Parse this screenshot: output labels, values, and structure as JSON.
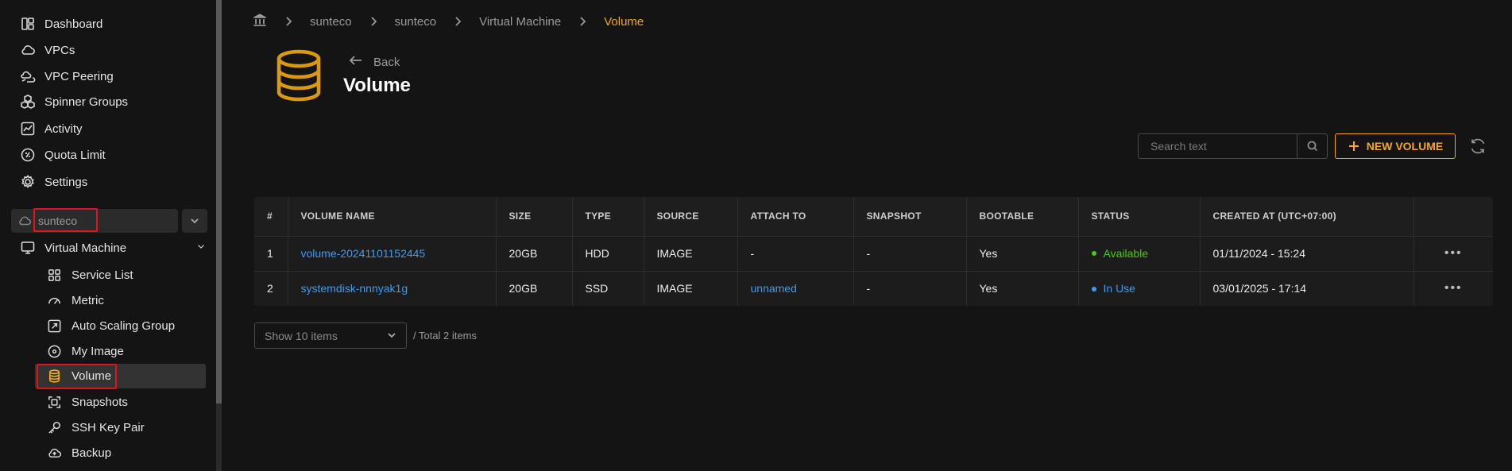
{
  "sidebar": {
    "items": [
      {
        "label": "Dashboard",
        "icon": "dashboard-icon"
      },
      {
        "label": "VPCs",
        "icon": "cloud-icon"
      },
      {
        "label": "VPC Peering",
        "icon": "cloud-link-icon"
      },
      {
        "label": "Spinner Groups",
        "icon": "cubes-icon"
      },
      {
        "label": "Activity",
        "icon": "chart-line-icon"
      },
      {
        "label": "Quota Limit",
        "icon": "quota-icon"
      },
      {
        "label": "Settings",
        "icon": "gear-icon"
      }
    ],
    "project": {
      "name": "sunteco"
    },
    "section": {
      "label": "Virtual Machine"
    },
    "sub_items": [
      {
        "label": "Service List"
      },
      {
        "label": "Metric"
      },
      {
        "label": "Auto Scaling Group"
      },
      {
        "label": "My Image"
      },
      {
        "label": "Volume"
      },
      {
        "label": "Snapshots"
      },
      {
        "label": "SSH Key Pair"
      },
      {
        "label": "Backup"
      }
    ],
    "active_item": "Volume"
  },
  "breadcrumb": [
    "sunteco",
    "sunteco",
    "Virtual Machine",
    "Volume"
  ],
  "header": {
    "back_label": "Back",
    "title": "Volume"
  },
  "toolbar": {
    "search_placeholder": "Search text",
    "new_button_label": "NEW VOLUME"
  },
  "table": {
    "columns": [
      "#",
      "VOLUME NAME",
      "SIZE",
      "TYPE",
      "SOURCE",
      "ATTACH TO",
      "SNAPSHOT",
      "BOOTABLE",
      "STATUS",
      "CREATED AT (UTC+07:00)"
    ],
    "rows": [
      {
        "index": "1",
        "name": "volume-20241101152445",
        "size": "20GB",
        "type": "HDD",
        "source": "IMAGE",
        "attach_to": "-",
        "snapshot": "-",
        "bootable": "Yes",
        "status": "Available",
        "created_at": "01/11/2024 - 15:24"
      },
      {
        "index": "2",
        "name": "systemdisk-nnnyak1g",
        "size": "20GB",
        "type": "SSD",
        "source": "IMAGE",
        "attach_to": "unnamed",
        "snapshot": "-",
        "bootable": "Yes",
        "status": "In Use",
        "created_at": "03/01/2025 - 17:14"
      }
    ]
  },
  "pagination": {
    "page_size_label": "Show 10 items",
    "total_label": "/ Total 2 items"
  },
  "colors": {
    "accent": "#f5a623",
    "link": "#3e9bf2",
    "status_available": "#52c41a",
    "status_in_use": "#3e9bf2",
    "highlight_box": "#e0141a"
  }
}
